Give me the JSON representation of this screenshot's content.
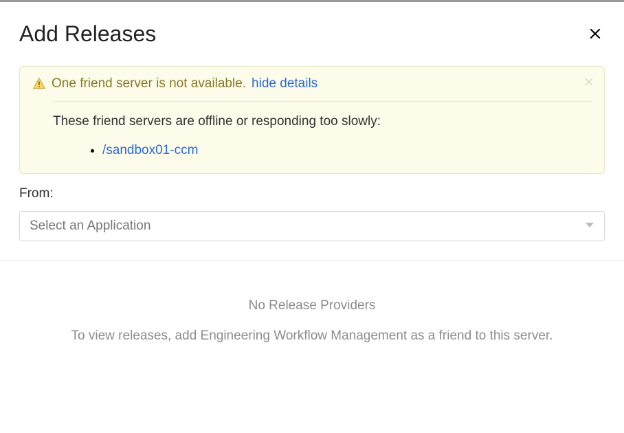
{
  "dialog": {
    "title": "Add Releases"
  },
  "warning": {
    "message": "One friend server is not available.",
    "toggle_label": "hide details",
    "details_text": "These friend servers are offline or responding too slowly:",
    "servers": [
      "/sandbox01-ccm"
    ]
  },
  "form": {
    "from_label": "From:",
    "select_placeholder": "Select an Application"
  },
  "empty_state": {
    "title": "No Release Providers",
    "description": "To view releases, add Engineering Workflow Management as a friend to this server."
  }
}
